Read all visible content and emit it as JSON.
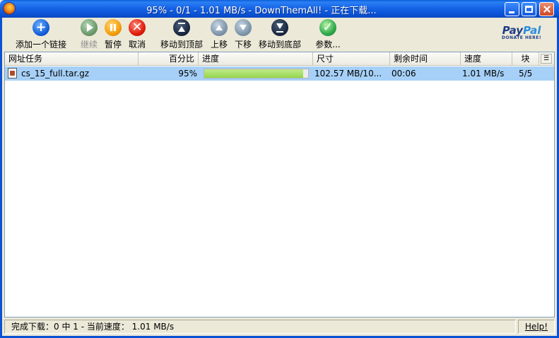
{
  "window": {
    "title": "95% - 0/1 - 1.01 MB/s - DownThemAll! - 正在下载..."
  },
  "toolbar": {
    "add_link": "添加一个链接",
    "resume": "继续",
    "pause": "暂停",
    "cancel": "取消",
    "move_top": "移动到顶部",
    "move_up": "上移",
    "move_down": "下移",
    "move_bottom": "移动到底部",
    "preferences": "参数..."
  },
  "paypal": {
    "logo_text_a": "Pay",
    "logo_text_b": "Pal",
    "tagline": "DONATE HERE!"
  },
  "columns": {
    "url": "网址任务",
    "percent": "百分比",
    "progress": "进度",
    "size": "尺寸",
    "remaining": "剩余时间",
    "speed": "速度",
    "chunks": "块"
  },
  "downloads": [
    {
      "name": "cs_15_full.tar.gz",
      "percent": "95%",
      "progress_fraction": 0.95,
      "size": "102.57 MB/10...",
      "remaining": "00:06",
      "speed": "1.01 MB/s",
      "chunks": "5/5"
    }
  ],
  "status": {
    "summary": "完成下载：0 中 1 - 当前速度： 1.01 MB/s",
    "help": "Help!"
  },
  "colors": {
    "titlebar": "#0a52d6",
    "row_selected": "#a6d0f7",
    "progress_fill": "#94d74c"
  }
}
